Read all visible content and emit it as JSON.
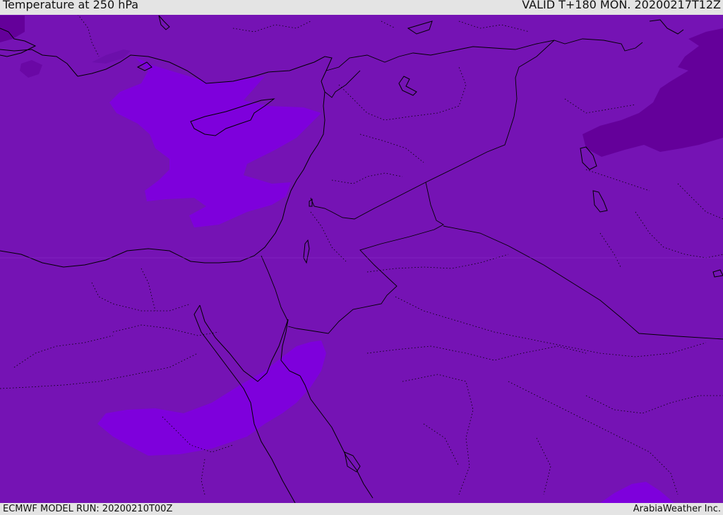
{
  "header": {
    "title": "Temperature at 250 hPa",
    "valid": "VALID T+180 MON. 20200217T12Z"
  },
  "footer": {
    "model_run": "ECMWF MODEL RUN: 20200210T00Z",
    "credit": "ArabiaWeather Inc."
  },
  "map": {
    "background_color": "#7513b4",
    "warm_zone_color": "#7e00dc",
    "cold_zone_color": "#64009a",
    "coastline_color": "#000000",
    "border_style": "solid",
    "province_border_style": "dotted"
  }
}
